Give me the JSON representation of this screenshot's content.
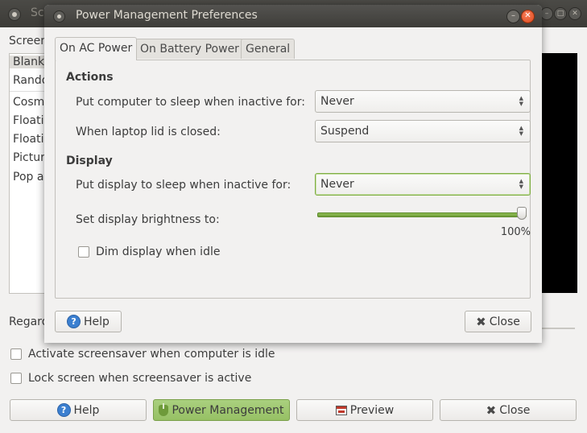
{
  "background_window": {
    "title": "Sc",
    "screensaver_label": "Screen",
    "themes": [
      "Blank",
      "Rando",
      "Cosm",
      "Floati",
      "Floati",
      "Pictur",
      "Pop a"
    ],
    "regard_label": "Regard",
    "activate_idle": "Activate screensaver when computer is idle",
    "lock_screen": "Lock screen when screensaver is active",
    "buttons": {
      "help": "Help",
      "power_management": "Power Management",
      "preview": "Preview",
      "close": "Close"
    }
  },
  "dialog": {
    "title": "Power Management Preferences",
    "tabs": [
      "On AC Power",
      "On Battery Power",
      "General"
    ],
    "actions_heading": "Actions",
    "sleep_computer_label": "Put computer to sleep when inactive for:",
    "sleep_computer_value": "Never",
    "lid_closed_label": "When laptop lid is closed:",
    "lid_closed_value": "Suspend",
    "display_heading": "Display",
    "sleep_display_label": "Put display to sleep when inactive for:",
    "sleep_display_value": "Never",
    "brightness_label": "Set display brightness to:",
    "brightness_value": "100%",
    "brightness_level": 1.0,
    "dim_label": "Dim display when idle",
    "help_button": "Help",
    "close_button": "Close"
  },
  "colors": {
    "accent_green": "#8fbd54",
    "close_orange": "#df4a1d",
    "titlebar": "#3e3d39"
  }
}
